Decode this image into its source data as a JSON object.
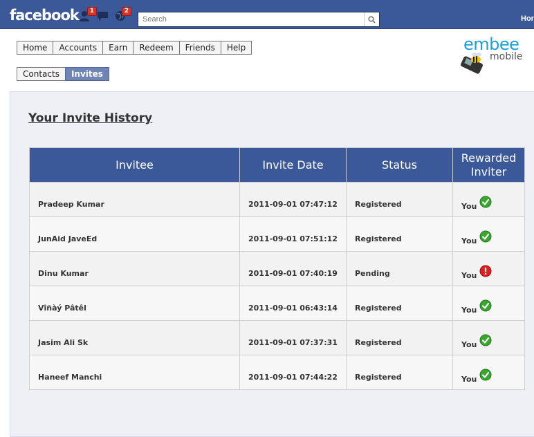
{
  "facebook": {
    "logo": "facebook",
    "friend_requests_count": "1",
    "notifications_count": "2",
    "search_placeholder": "Search",
    "home_link": "Hor",
    "colors": {
      "bar": "#3b5998",
      "badge": "#d9322a"
    }
  },
  "nav": {
    "items": [
      "Home",
      "Accounts",
      "Earn",
      "Redeem",
      "Friends",
      "Help"
    ]
  },
  "subnav": {
    "items": [
      "Contacts",
      "Invites"
    ],
    "active": "Invites"
  },
  "brand": {
    "name": "embee",
    "tagline": "mobile",
    "color": "#1ba0d8"
  },
  "history": {
    "title": "Your Invite History",
    "columns": [
      "Invitee",
      "Invite Date",
      "Status",
      "Rewarded Inviter"
    ],
    "rows": [
      {
        "invitee": "Pradeep Kumar",
        "date": "2011-09-01 07:47:12",
        "status": "Registered",
        "rewarded": "You",
        "icon": "check-icon"
      },
      {
        "invitee": "JunAid JaveEd",
        "date": "2011-09-01 07:51:12",
        "status": "Registered",
        "rewarded": "You",
        "icon": "check-icon"
      },
      {
        "invitee": "Dinu Kumar",
        "date": "2011-09-01 07:40:19",
        "status": "Pending",
        "rewarded": "You",
        "icon": "alert-icon"
      },
      {
        "invitee": "Vîñàý Pâtêl",
        "date": "2011-09-01 06:43:14",
        "status": "Registered",
        "rewarded": "You",
        "icon": "check-icon"
      },
      {
        "invitee": "Jasim Ali Sk",
        "date": "2011-09-01 07:37:31",
        "status": "Registered",
        "rewarded": "You",
        "icon": "check-icon"
      },
      {
        "invitee": "Haneef Manchi",
        "date": "2011-09-01 07:44:22",
        "status": "Registered",
        "rewarded": "You",
        "icon": "check-icon"
      }
    ]
  }
}
